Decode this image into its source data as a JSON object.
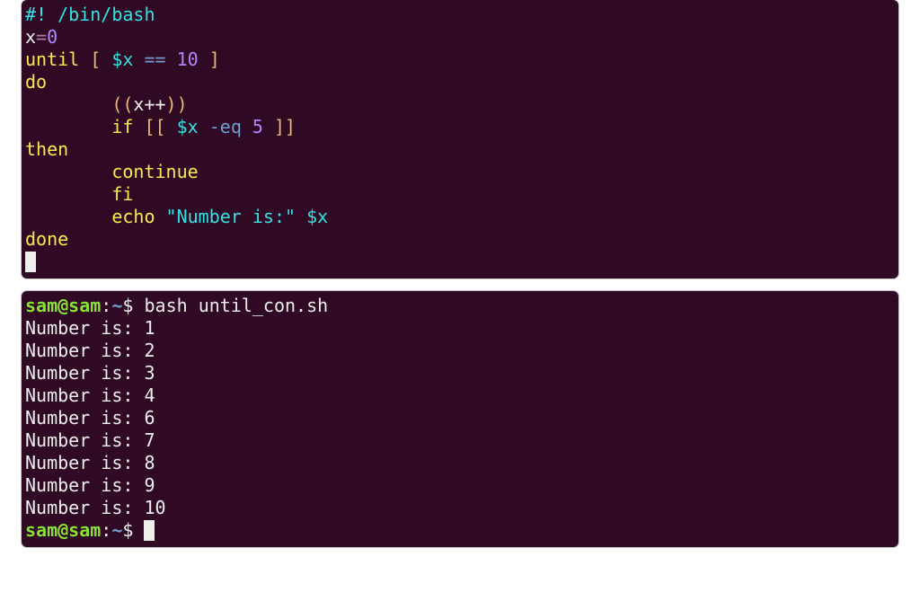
{
  "editor": {
    "lines": [
      {
        "segments": [
          {
            "t": "#! /bin/bash",
            "cls": "c-cyan"
          }
        ]
      },
      {
        "segments": [
          {
            "t": "x",
            "cls": "c-white"
          },
          {
            "t": "=",
            "cls": "c-purple"
          },
          {
            "t": "0",
            "cls": "c-num"
          }
        ]
      },
      {
        "segments": [
          {
            "t": "until",
            "cls": "c-yellow"
          },
          {
            "t": " ",
            "cls": "c-white"
          },
          {
            "t": "[ ",
            "cls": "c-orange"
          },
          {
            "t": "$x",
            "cls": "c-var"
          },
          {
            "t": " ",
            "cls": "c-white"
          },
          {
            "t": "==",
            "cls": "c-op"
          },
          {
            "t": " ",
            "cls": "c-white"
          },
          {
            "t": "10",
            "cls": "c-num"
          },
          {
            "t": " ]",
            "cls": "c-orange"
          }
        ]
      },
      {
        "segments": [
          {
            "t": "do",
            "cls": "c-yellow"
          }
        ]
      },
      {
        "segments": [
          {
            "t": "        ",
            "cls": "c-white"
          },
          {
            "t": "((",
            "cls": "c-orange"
          },
          {
            "t": "x++",
            "cls": "c-white"
          },
          {
            "t": "))",
            "cls": "c-orange"
          }
        ]
      },
      {
        "segments": [
          {
            "t": "        ",
            "cls": "c-white"
          },
          {
            "t": "if",
            "cls": "c-yellow"
          },
          {
            "t": " ",
            "cls": "c-white"
          },
          {
            "t": "[[ ",
            "cls": "c-orange"
          },
          {
            "t": "$x",
            "cls": "c-var"
          },
          {
            "t": " ",
            "cls": "c-white"
          },
          {
            "t": "-eq",
            "cls": "c-op"
          },
          {
            "t": " ",
            "cls": "c-white"
          },
          {
            "t": "5",
            "cls": "c-num"
          },
          {
            "t": " ]]",
            "cls": "c-orange"
          }
        ]
      },
      {
        "segments": [
          {
            "t": "then",
            "cls": "c-yellow"
          }
        ]
      },
      {
        "segments": [
          {
            "t": "        ",
            "cls": "c-white"
          },
          {
            "t": "continue",
            "cls": "c-yellow"
          }
        ]
      },
      {
        "segments": [
          {
            "t": "        ",
            "cls": "c-white"
          },
          {
            "t": "fi",
            "cls": "c-yellow"
          }
        ]
      },
      {
        "segments": [
          {
            "t": "        ",
            "cls": "c-white"
          },
          {
            "t": "echo",
            "cls": "c-yellow"
          },
          {
            "t": " ",
            "cls": "c-white"
          },
          {
            "t": "\"Number is:\"",
            "cls": "c-str"
          },
          {
            "t": " ",
            "cls": "c-white"
          },
          {
            "t": "$x",
            "cls": "c-var"
          }
        ]
      },
      {
        "segments": [
          {
            "t": "done",
            "cls": "c-yellow"
          }
        ]
      }
    ]
  },
  "shell": {
    "prompt": {
      "userhost": "sam@sam",
      "sep": ":",
      "path": "~",
      "dollar": "$"
    },
    "command": "bash until_con.sh",
    "output": [
      "Number is: 1",
      "Number is: 2",
      "Number is: 3",
      "Number is: 4",
      "Number is: 6",
      "Number is: 7",
      "Number is: 8",
      "Number is: 9",
      "Number is: 10"
    ]
  }
}
